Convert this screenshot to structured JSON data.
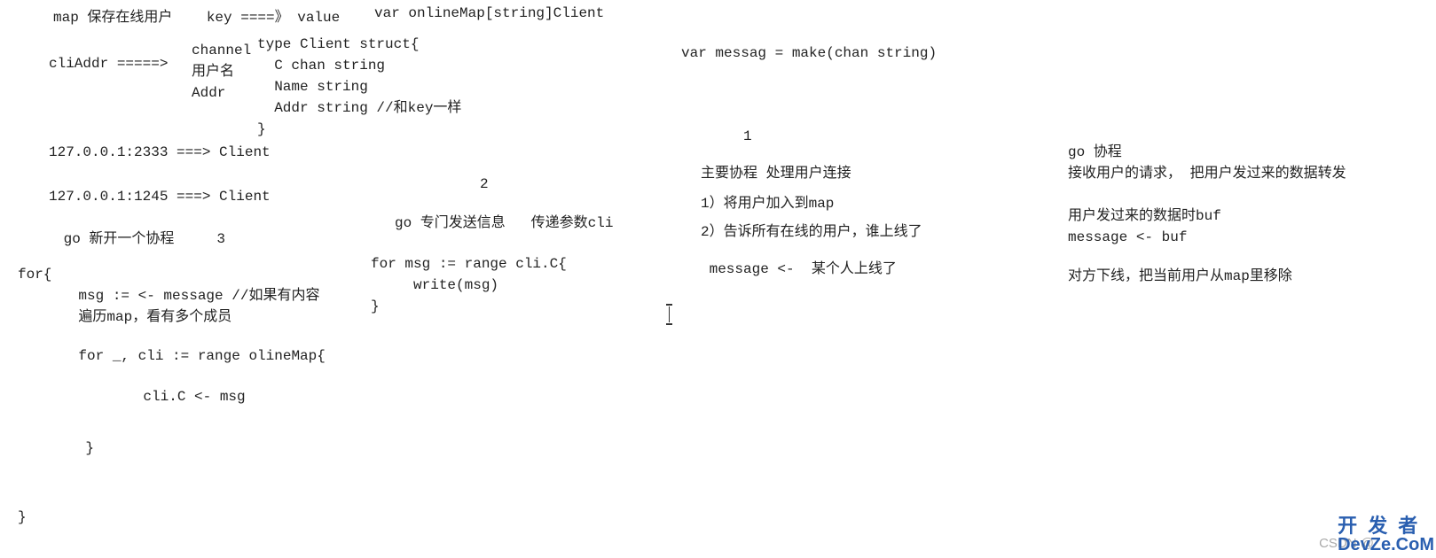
{
  "left": {
    "l1": "map 保存在线用户    key ====》 value",
    "l2": "cliAddr =====>",
    "l2b": "channel\n用户名\nAddr",
    "l3": "127.0.0.1:2333 ===> Client",
    "l4": "127.0.0.1:1245 ===> Client",
    "l5": " go 新开一个协程     3",
    "l6": "for{",
    "l7": "    msg := <- message //如果有内容\n    遍历map，看有多个成员",
    "l8": "    for _, cli := range olineMap{",
    "l9": "         cli.C <- msg",
    "l10": "    }",
    "l11": "}"
  },
  "mid": {
    "m1": "var onlineMap[string]Client",
    "m2": "type Client struct{\n  C chan string\n  Name string\n  Addr string //和key一样\n}",
    "m3": "          2",
    "m4": "go 专门发送信息   传递参数cli",
    "m5": "for msg := range cli.C{\n     write(msg)\n}"
  },
  "right1": {
    "r1": "var messag = make(chan string)",
    "r2": "     1",
    "r3": "主要协程 处理用户连接",
    "r4": "1）将用户加入到map",
    "r5": "2）告诉所有在线的用户，谁上线了",
    "r6": " message <-  某个人上线了"
  },
  "right2": {
    "s1": "go 协程",
    "s2": "接收用户的请求， 把用户发过来的数据转发",
    "s3": "用户发过来的数据时buf",
    "s4": "message <- buf",
    "s5": "对方下线，把当前用户从map里移除"
  },
  "watermark": {
    "csdn": "CSDN @",
    "brand1": "开 发 者",
    "brand2": "DevZe.CoM"
  }
}
